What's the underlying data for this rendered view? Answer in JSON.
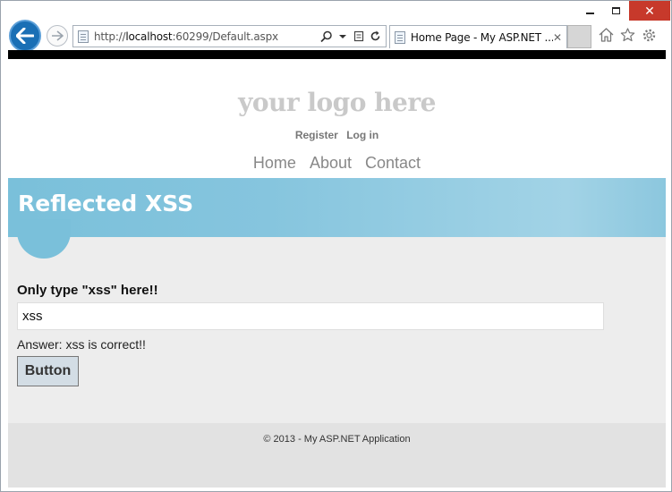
{
  "browser": {
    "window_controls": {
      "minimize": "",
      "maximize": "",
      "close": "✕"
    },
    "address_bar": {
      "url_prefix": "http://",
      "url_host": "localhost",
      "url_rest": ":60299/Default.aspx"
    },
    "tab": {
      "title": "Home Page - My ASP.NET ...",
      "close": "✕"
    }
  },
  "site": {
    "logo": "your logo here",
    "account_links": [
      "Register",
      "Log in"
    ],
    "menu": [
      "Home",
      "About",
      "Contact"
    ]
  },
  "featured": {
    "title": "Reflected XSS"
  },
  "form": {
    "question_label": "Only type \"xss\" here!!",
    "input_value": "xss",
    "answer_text": "Answer: xss is correct!!",
    "button_label": "Button"
  },
  "footer": {
    "text": "© 2013 - My ASP.NET Application"
  },
  "colors": {
    "accent": "#7ac0da",
    "browser_back": "#1a6fb5",
    "close_button": "#c7392b",
    "body_bg": "#ededed",
    "footer_bg": "#e2e2e2",
    "logo_text": "#c9c9c9"
  }
}
